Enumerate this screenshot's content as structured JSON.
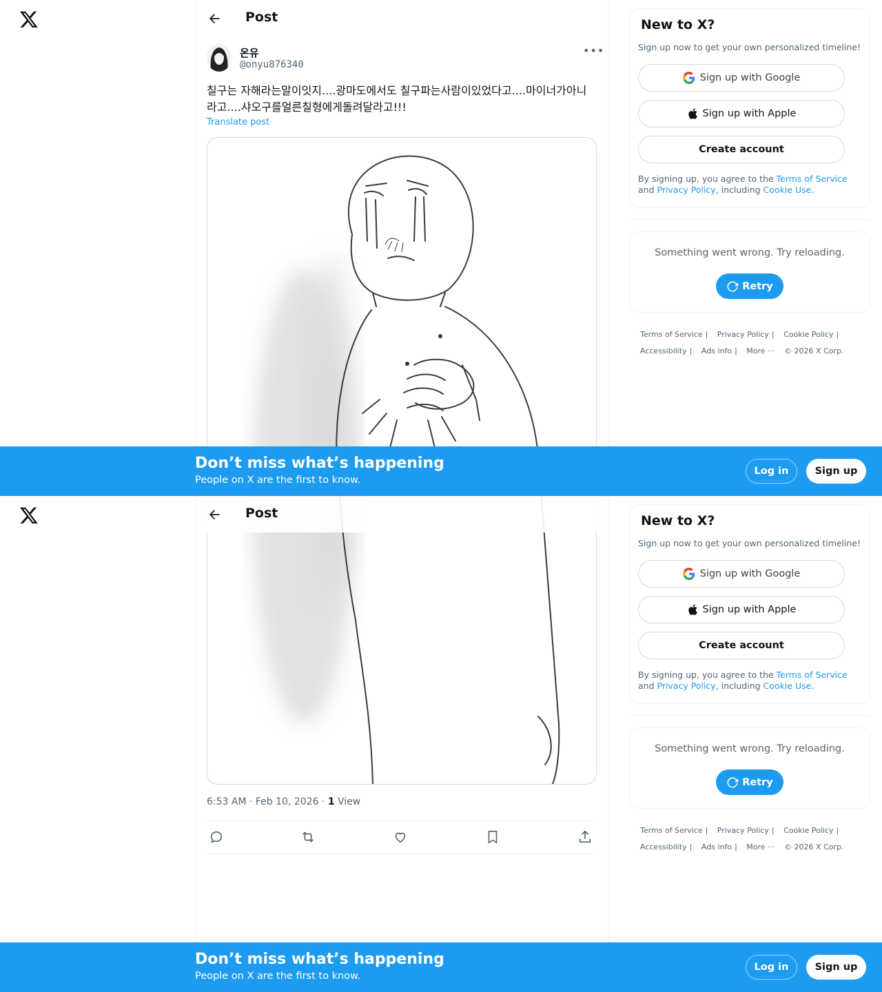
{
  "nav": {
    "logo_icon": "x-logo-icon"
  },
  "header": {
    "title": "Post",
    "back_icon": "back-arrow-icon"
  },
  "post": {
    "author_name": "온유",
    "author_handle": "@onyu876340",
    "text": "칠구는 자해라는말이잇지....광마도에서도 칠구파는사람이있었다고....마이너가아니라고....샤오구를얼른칠형에게돌려달라고!!!",
    "translate_label": "Translate post",
    "timestamp": "6:53 AM · Feb 10, 2026 · ",
    "views_count": "1",
    "views_label": " View",
    "media_alt": "Drawing of a crying figure clutching its chest",
    "actions": [
      "reply-icon",
      "repost-icon",
      "like-icon",
      "bookmark-icon",
      "share-icon"
    ]
  },
  "signup_card": {
    "title": "New to X?",
    "subtitle": "Sign up now to get your own personalized timeline!",
    "google_label": "Sign up with Google",
    "apple_label": "Sign up with Apple",
    "create_label": "Create account",
    "legal_prefix": "By signing up, you agree to the ",
    "terms_link": "Terms of Service",
    "legal_and": " and ",
    "privacy_link": "Privacy Policy",
    "legal_including": ", including ",
    "cookie_link": "Cookie Use."
  },
  "error_card": {
    "message": "Something went wrong. Try reloading.",
    "retry_label": "Retry"
  },
  "footer": {
    "terms": "Terms of Service",
    "privacy": "Privacy Policy",
    "cookie": "Cookie Policy",
    "accessibility": "Accessibility",
    "ads": "Ads info",
    "more": "More ···",
    "copyright": "© 2026 X Corp."
  },
  "banner": {
    "title": "Don’t miss what’s happening",
    "subtitle": "People on X are the first to know.",
    "login_label": "Log in",
    "signup_label": "Sign up"
  },
  "colors": {
    "accent": "#1d9bf0",
    "text": "#0f1419",
    "muted": "#536471",
    "border": "#eff3f4"
  }
}
